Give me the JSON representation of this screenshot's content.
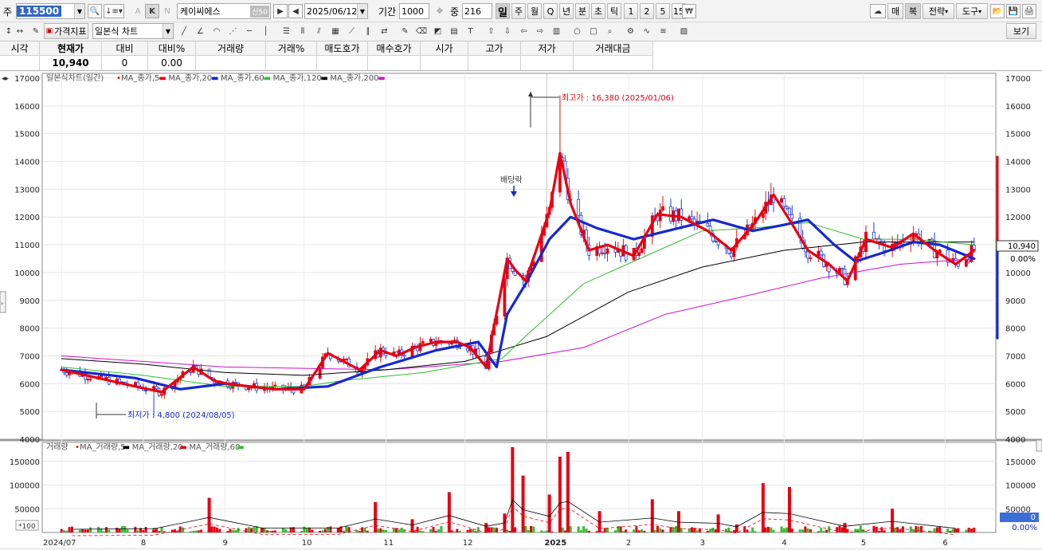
{
  "toolbar": {
    "market_label": "주",
    "stock_code": "115500",
    "stock_name": "케이씨에스",
    "market_badge": "신50",
    "date": "2025/06/12",
    "period_label": "기간",
    "period_value": "1000",
    "count_label": "중",
    "count_value": "216",
    "intervals": [
      "일",
      "주",
      "월",
      "Q",
      "년",
      "분",
      "초",
      "틱",
      "1",
      "2",
      "5",
      "15"
    ],
    "k_label": "K",
    "n_label": "N",
    "a_label": "A",
    "right_buttons": [
      "매",
      "복",
      "전략",
      "도구"
    ],
    "indicator_label": "가격지표",
    "chart_type": "일본식 차트",
    "view_label": "보기"
  },
  "quote": {
    "headers": [
      "시각",
      "현재가",
      "대비",
      "대비%",
      "거래량",
      "거래%",
      "매도호가",
      "매수호가",
      "시가",
      "고가",
      "저가",
      "거래대금"
    ],
    "values": [
      "",
      "10,940",
      "0",
      "0.00",
      "",
      "",
      "",
      "",
      "",
      "",
      "",
      ""
    ]
  },
  "price_legend": {
    "title": "일본식차트(일간)",
    "items": [
      "MA_종가,5",
      "MA_종가,20",
      "MA_종가,60",
      "MA_종가,120",
      "MA_종가,200"
    ],
    "colors": [
      "#e60012",
      "#e60012",
      "#1428d2",
      "#2fbf2f",
      "#000000",
      "#d010c8"
    ]
  },
  "volume_legend": {
    "title": "거래량",
    "items": [
      "MA_거래량,5",
      "MA_거래량,20",
      "MA_거래량,60"
    ],
    "colors": [
      "#e60012",
      "#000000",
      "#e60012",
      "#2fbf2f"
    ]
  },
  "annotations": {
    "high": "최고가 : 16,380 (2025/01/06)",
    "low": "최저가 : 4,800 (2024/08/05)",
    "dividend": "배당락",
    "current_price_label": "10,940",
    "current_change_label": "0.00%",
    "volume_current_label": "0",
    "volume_change_label": "0.00%",
    "volume_unit": "*100"
  },
  "chart_data": [
    {
      "type": "line",
      "title": "일본식차트(일간)",
      "ylim": [
        4000,
        17000
      ],
      "y_ticks": [
        4000,
        5000,
        6000,
        7000,
        8000,
        9000,
        10000,
        11000,
        12000,
        13000,
        14000,
        15000,
        16000,
        17000
      ],
      "x_labels": [
        "2024/07",
        "8",
        "9",
        "10",
        "11",
        "12",
        "2025",
        "2",
        "3",
        "4",
        "5",
        "6"
      ],
      "x_label_dates": [
        "2024-07-01",
        "2024-08-01",
        "2024-09-01",
        "2024-10-01",
        "2024-11-01",
        "2024-12-01",
        "2025-01-01",
        "2025-02-01",
        "2025-03-01",
        "2025-04-01",
        "2025-05-01",
        "2025-06-01"
      ],
      "series": [
        {
          "name": "MA_종가,5",
          "color": "#e60012",
          "x": [
            "2024-07-01",
            "2024-07-15",
            "2024-07-29",
            "2024-08-08",
            "2024-08-20",
            "2024-08-28",
            "2024-09-02",
            "2024-09-10",
            "2024-09-20",
            "2024-10-01",
            "2024-10-10",
            "2024-10-22",
            "2024-10-30",
            "2024-11-05",
            "2024-11-12",
            "2024-11-20",
            "2024-11-28",
            "2024-12-03",
            "2024-12-09",
            "2024-12-17",
            "2024-12-20",
            "2024-12-24",
            "2025-01-02",
            "2025-01-06",
            "2025-01-10",
            "2025-01-17",
            "2025-01-24",
            "2025-02-03",
            "2025-02-12",
            "2025-02-21",
            "2025-03-03",
            "2025-03-12",
            "2025-03-21",
            "2025-03-28",
            "2025-04-03",
            "2025-04-10",
            "2025-04-18",
            "2025-04-25",
            "2025-05-02",
            "2025-05-12",
            "2025-05-20",
            "2025-05-28",
            "2025-06-05",
            "2025-06-12"
          ],
          "y": [
            6500,
            6200,
            5900,
            5700,
            6600,
            6100,
            6000,
            5900,
            5800,
            5800,
            7100,
            6500,
            7200,
            7000,
            7300,
            7500,
            7500,
            7300,
            6600,
            10500,
            10100,
            9700,
            12200,
            14300,
            12500,
            10800,
            11000,
            10600,
            12100,
            12000,
            11500,
            10800,
            11800,
            12800,
            11900,
            10800,
            10300,
            9700,
            11200,
            10900,
            11400,
            10800,
            10300,
            10800
          ]
        },
        {
          "name": "MA_종가,20",
          "color": "#1428d2",
          "x": [
            "2024-07-01",
            "2024-07-29",
            "2024-08-15",
            "2024-09-01",
            "2024-09-20",
            "2024-10-10",
            "2024-10-30",
            "2024-11-20",
            "2024-12-06",
            "2024-12-13",
            "2024-12-17",
            "2024-12-24",
            "2025-01-02",
            "2025-01-10",
            "2025-01-20",
            "2025-02-03",
            "2025-02-20",
            "2025-03-05",
            "2025-03-20",
            "2025-03-31",
            "2025-04-10",
            "2025-04-20",
            "2025-04-28",
            "2025-05-08",
            "2025-05-20",
            "2025-05-30",
            "2025-06-12"
          ],
          "y": [
            6500,
            6200,
            5800,
            6000,
            5800,
            5900,
            6600,
            7200,
            7500,
            6600,
            8500,
            9600,
            11200,
            12000,
            11600,
            11200,
            11600,
            11900,
            11500,
            11700,
            11900,
            11000,
            10400,
            10700,
            11100,
            11000,
            10500
          ]
        },
        {
          "name": "MA_종가,60",
          "color": "#2fbf2f",
          "x": [
            "2024-07-01",
            "2024-08-01",
            "2024-09-01",
            "2024-10-01",
            "2024-10-15",
            "2024-11-15",
            "2024-12-15",
            "2024-12-25",
            "2025-01-15",
            "2025-02-10",
            "2025-03-01",
            "2025-03-20",
            "2025-04-10",
            "2025-05-01",
            "2025-05-20",
            "2025-06-12"
          ],
          "y": [
            6600,
            6300,
            5900,
            5900,
            6100,
            6400,
            6900,
            7800,
            9600,
            10700,
            11500,
            11600,
            11800,
            11200,
            11200,
            11000
          ]
        },
        {
          "name": "MA_종가,120",
          "color": "#000000",
          "x": [
            "2024-07-01",
            "2024-08-01",
            "2024-09-01",
            "2024-10-01",
            "2024-11-01",
            "2024-12-01",
            "2025-01-01",
            "2025-02-01",
            "2025-03-01",
            "2025-04-01",
            "2025-05-01",
            "2025-06-12"
          ],
          "y": [
            6900,
            6700,
            6400,
            6300,
            6500,
            6800,
            7700,
            9300,
            10200,
            10800,
            11100,
            11100
          ]
        },
        {
          "name": "MA_종가,200",
          "color": "#d010c8",
          "x": [
            "2024-07-01",
            "2024-09-01",
            "2024-11-01",
            "2024-12-15",
            "2025-01-15",
            "2025-02-15",
            "2025-03-15",
            "2025-04-15",
            "2025-05-15",
            "2025-06-12"
          ],
          "y": [
            7000,
            6600,
            6500,
            6800,
            7300,
            8500,
            9100,
            9800,
            10300,
            10500
          ]
        }
      ]
    },
    {
      "type": "bar",
      "title": "거래량",
      "ylim": [
        0,
        190000
      ],
      "y_ticks": [
        50000,
        100000,
        150000
      ],
      "x": [
        "2024-07-05",
        "2024-08-05",
        "2024-08-26",
        "2024-09-15",
        "2024-10-14",
        "2024-10-28",
        "2024-11-11",
        "2024-11-25",
        "2024-12-09",
        "2024-12-16",
        "2024-12-19",
        "2024-12-23",
        "2025-01-02",
        "2025-01-06",
        "2025-01-09",
        "2025-01-21",
        "2025-02-10",
        "2025-02-20",
        "2025-03-07",
        "2025-03-14",
        "2025-03-24",
        "2025-04-03",
        "2025-04-24",
        "2025-05-12",
        "2025-06-05"
      ],
      "values": [
        2000,
        5000,
        73000,
        10000,
        10000,
        64000,
        28000,
        85000,
        20000,
        40000,
        180000,
        120000,
        80000,
        160000,
        170000,
        45000,
        70000,
        45000,
        38000,
        17000,
        104000,
        96000,
        20000,
        50000,
        8000
      ]
    }
  ]
}
